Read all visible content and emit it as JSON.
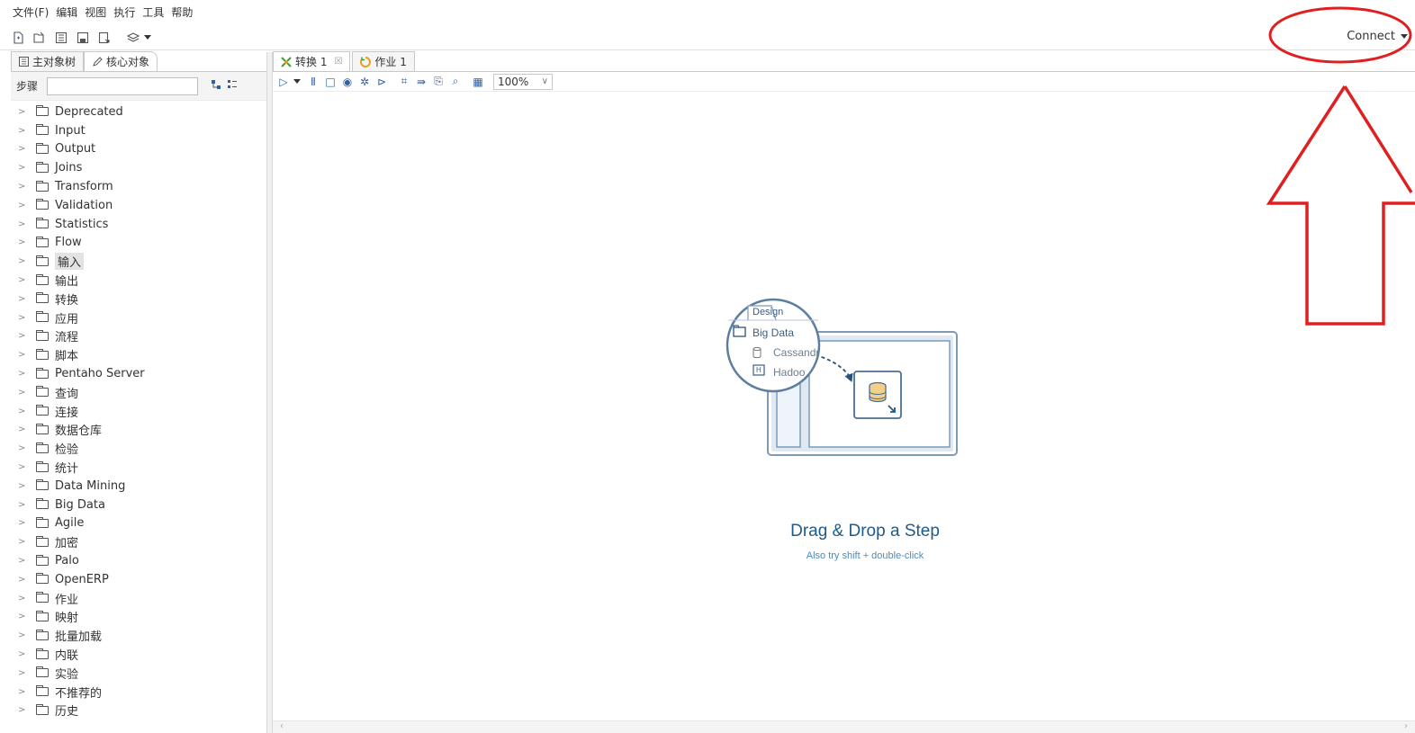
{
  "menu": [
    "文件(F)",
    "编辑",
    "视图",
    "执行",
    "工具",
    "帮助"
  ],
  "toolbar": {
    "icons": [
      "new-file-icon",
      "open-icon",
      "explore-repo-icon",
      "save-icon",
      "save-as-icon",
      "layers-icon"
    ],
    "connect_label": "Connect"
  },
  "left_panel": {
    "tabs": [
      "主对象树",
      "核心对象"
    ],
    "search_label": "步骤",
    "search_value": "",
    "tree_items": [
      "Deprecated",
      "Input",
      "Output",
      "Joins",
      "Transform",
      "Validation",
      "Statistics",
      "Flow",
      "输入",
      "输出",
      "转换",
      "应用",
      "流程",
      "脚本",
      "Pentaho Server",
      "查询",
      "连接",
      "数据仓库",
      "检验",
      "统计",
      "Data Mining",
      "Big Data",
      "Agile",
      "加密",
      "Palo",
      "OpenERP",
      "作业",
      "映射",
      "批量加载",
      "内联",
      "实验",
      "不推荐的",
      "历史"
    ],
    "selected_item": "输入"
  },
  "editor": {
    "tabs": [
      {
        "label": "转换 1",
        "close": "☒"
      },
      {
        "label": "作业 1",
        "close": ""
      }
    ],
    "zoom": "100%"
  },
  "canvas": {
    "illustration": {
      "design_tab": "Design",
      "big_data": "Big Data",
      "cassandra": "Cassandr",
      "hadoop": "Hadoo"
    },
    "title": "Drag & Drop a Step",
    "subtitle": "Also try shift + double-click"
  },
  "colors": {
    "accent": "#1e5a8a",
    "annotation": "#e02020"
  }
}
